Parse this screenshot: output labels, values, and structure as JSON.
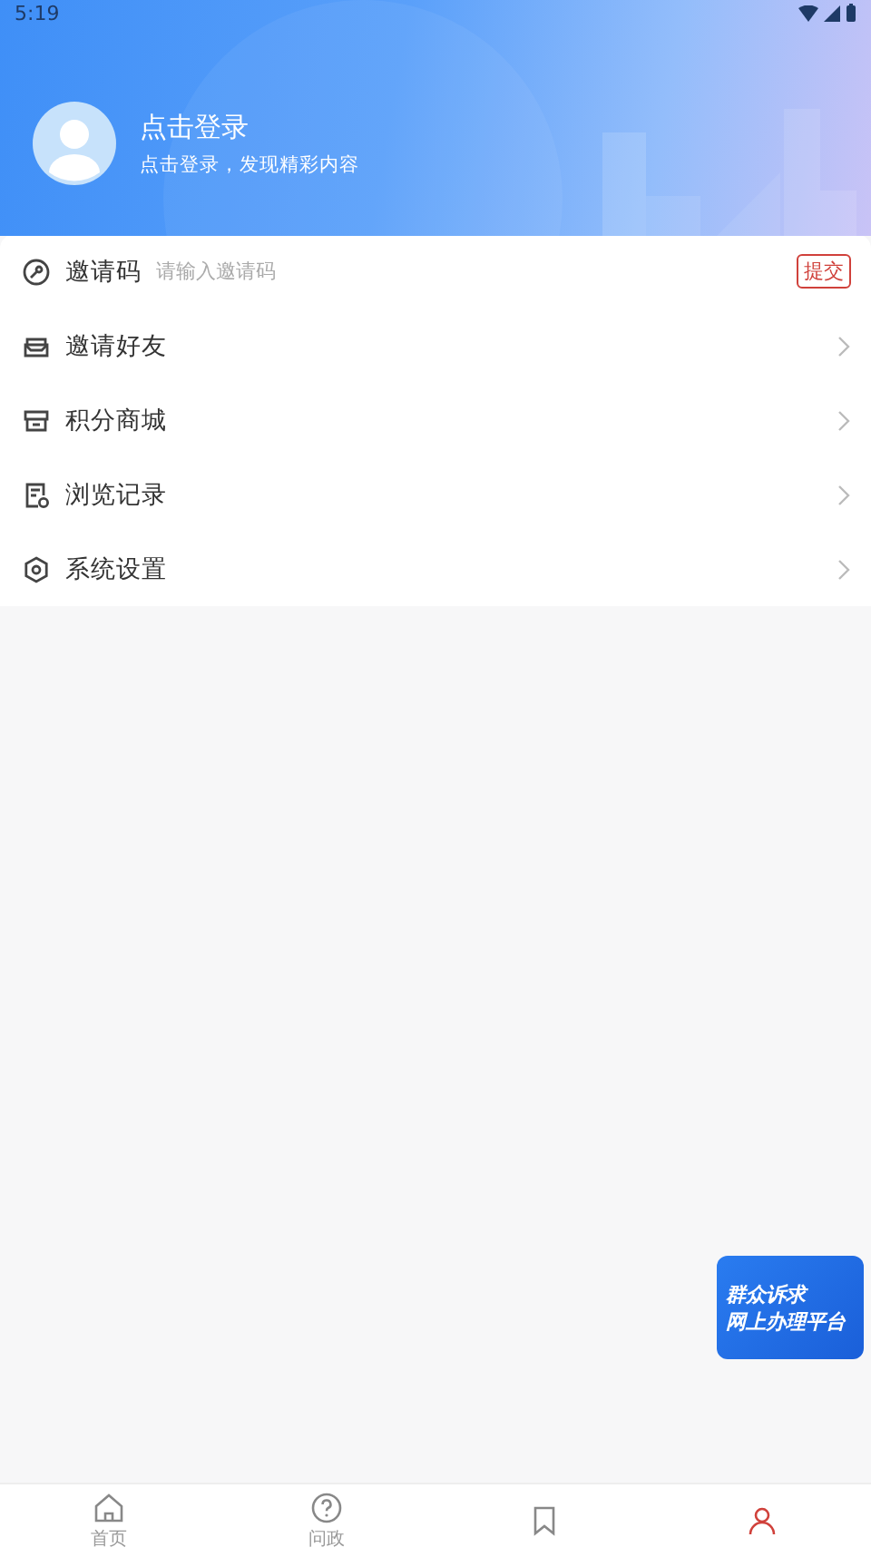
{
  "status_bar": {
    "time": "5:19"
  },
  "profile": {
    "title": "点击登录",
    "subtitle": "点击登录，发现精彩内容"
  },
  "invite": {
    "label": "邀请码",
    "placeholder": "请输入邀请码",
    "submit": "提交"
  },
  "menu": [
    {
      "kind": "friends",
      "label": "邀请好友"
    },
    {
      "kind": "mall",
      "label": "积分商城"
    },
    {
      "kind": "history",
      "label": "浏览记录"
    },
    {
      "kind": "settings",
      "label": "系统设置"
    }
  ],
  "float_banner": {
    "lines": [
      "群众诉求",
      "网上办理平台"
    ]
  },
  "tabs": [
    {
      "kind": "home",
      "label": "首页",
      "selected": false
    },
    {
      "kind": "ask",
      "label": "问政",
      "selected": false
    },
    {
      "kind": "bookmark",
      "selected": false
    },
    {
      "kind": "person",
      "selected": true
    }
  ]
}
